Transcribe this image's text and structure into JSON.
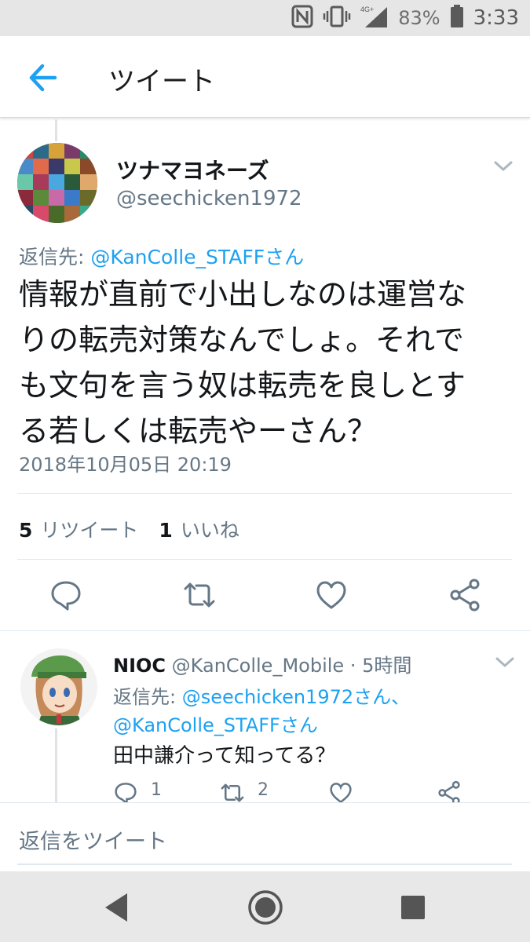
{
  "status_bar": {
    "battery_percent": "83%",
    "time": "3:33",
    "network_label": "4G+",
    "icons": [
      "nfc-icon",
      "vibrate-icon",
      "signal-icon",
      "battery-icon"
    ]
  },
  "header": {
    "title": "ツイート",
    "back_icon": "arrow-left-icon"
  },
  "tweet": {
    "display_name": "ツナマヨネーズ",
    "handle": "@seechicken1972",
    "reply_prefix": "返信先: ",
    "reply_to": "@KanColle_STAFFさん",
    "text_lines": [
      "情報が直前で小出しなのは運営な",
      "りの転売対策なんでしょ。それで",
      "も文句を言う奴は転売を良しとす",
      "る若しくは転売やーさん？"
    ],
    "timestamp": "2018年10月05日 20:19",
    "retweet_count": "5",
    "retweet_label": "リツイート",
    "like_count": "1",
    "like_label": "いいね"
  },
  "reply": {
    "display_name": "NIOC",
    "handle": "@KanColle_Mobile",
    "separator": " · ",
    "time_ago": "5時間",
    "reply_prefix": "返信先: ",
    "reply_to_1": "@seechicken1972さん、",
    "reply_to_2": "@KanColle_STAFFさん",
    "text": "田中謙介って知ってる？",
    "reply_count": "1",
    "retweet_count": "2"
  },
  "compose": {
    "placeholder": "返信をツイート"
  },
  "colors": {
    "accent": "#1da1f2",
    "secondary_text": "#657786",
    "primary_text": "#14171a",
    "divider": "#e1e8ed"
  }
}
